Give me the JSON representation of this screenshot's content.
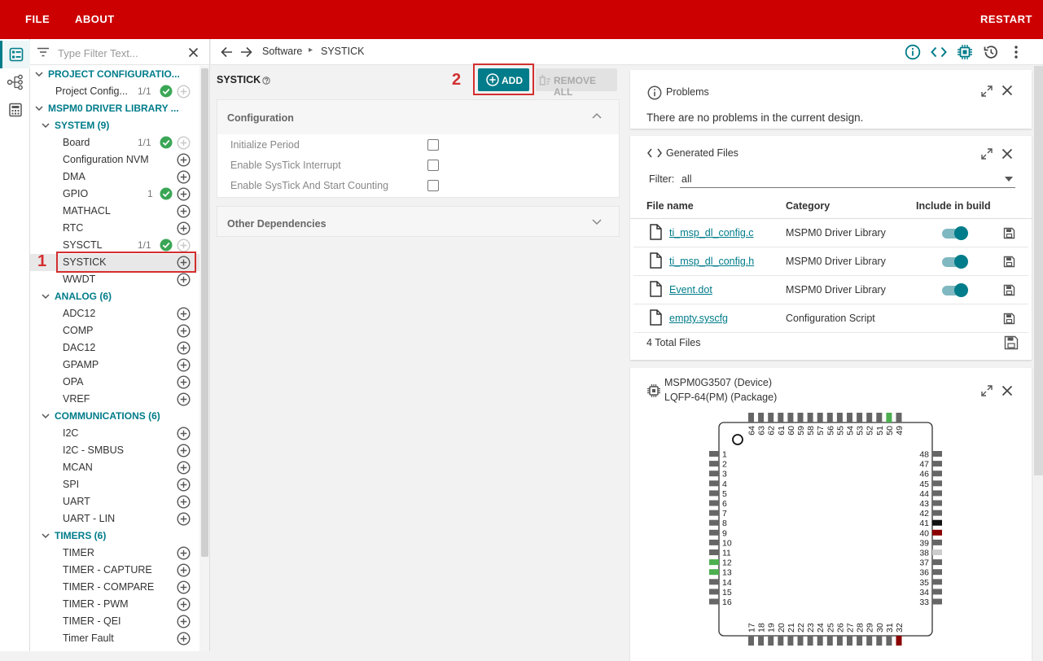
{
  "menu": {
    "file": "FILE",
    "about": "ABOUT",
    "restart": "RESTART"
  },
  "filter": {
    "placeholder": "Type Filter Text..."
  },
  "tree": {
    "project_config": {
      "title": "PROJECT CONFIGURATIO...",
      "items": [
        {
          "label": "Project Config...",
          "count": "1/1"
        }
      ]
    },
    "driver_lib": {
      "title": "MSPM0 DRIVER LIBRARY ..."
    },
    "system": {
      "title": "SYSTEM (9)",
      "items": [
        {
          "label": "Board",
          "count": "1/1"
        },
        {
          "label": "Configuration NVM",
          "count": ""
        },
        {
          "label": "DMA",
          "count": ""
        },
        {
          "label": "GPIO",
          "count": "1"
        },
        {
          "label": "MATHACL",
          "count": ""
        },
        {
          "label": "RTC",
          "count": ""
        },
        {
          "label": "SYSCTL",
          "count": "1/1"
        },
        {
          "label": "SYSTICK",
          "count": ""
        },
        {
          "label": "WWDT",
          "count": ""
        }
      ]
    },
    "analog": {
      "title": "ANALOG (6)",
      "items": [
        "ADC12",
        "COMP",
        "DAC12",
        "GPAMP",
        "OPA",
        "VREF"
      ]
    },
    "communications": {
      "title": "COMMUNICATIONS (6)",
      "items": [
        "I2C",
        "I2C - SMBUS",
        "MCAN",
        "SPI",
        "UART",
        "UART - LIN"
      ]
    },
    "timers": {
      "title": "TIMERS (6)",
      "items": [
        "TIMER",
        "TIMER - CAPTURE",
        "TIMER - COMPARE",
        "TIMER - PWM",
        "TIMER - QEI",
        "Timer Fault"
      ]
    }
  },
  "annotations": {
    "first": "1",
    "second": "2"
  },
  "breadcrumb": {
    "root": "Software",
    "current": "SYSTICK"
  },
  "module": {
    "title": "SYSTICK",
    "add_label": "ADD",
    "remove_all_label": "REMOVE ALL",
    "config_section": "Configuration",
    "options": [
      {
        "label": "Initialize Period",
        "checked": false
      },
      {
        "label": "Enable SysTick Interrupt",
        "checked": false
      },
      {
        "label": "Enable SysTick And Start Counting",
        "checked": false
      }
    ],
    "deps_section": "Other Dependencies"
  },
  "problems": {
    "title": "Problems",
    "message": "There are no problems in the current design."
  },
  "generated": {
    "title": "Generated Files",
    "filter_label": "Filter:",
    "filter_value": "all",
    "columns": [
      "File name",
      "Category",
      "Include in build"
    ],
    "files": [
      {
        "name": "ti_msp_dl_config.c",
        "category": "MSPM0 Driver Library",
        "include": true
      },
      {
        "name": "ti_msp_dl_config.h",
        "category": "MSPM0 Driver Library",
        "include": true
      },
      {
        "name": "Event.dot",
        "category": "MSPM0 Driver Library",
        "include": true
      },
      {
        "name": "empty.syscfg",
        "category": "Configuration Script",
        "include": null
      }
    ],
    "total": "4 Total Files"
  },
  "device": {
    "device_line": "MSPM0G3507 (Device)",
    "package_line": "LQFP-64(PM) (Package)",
    "pins_left": [
      "1",
      "2",
      "3",
      "4",
      "5",
      "6",
      "7",
      "8",
      "9",
      "10",
      "11",
      "12",
      "13",
      "14",
      "15",
      "16"
    ],
    "pins_bottom": [
      "17",
      "18",
      "19",
      "20",
      "21",
      "22",
      "23",
      "24",
      "25",
      "26",
      "27",
      "28",
      "29",
      "30",
      "31",
      "32"
    ],
    "pins_right": [
      "33",
      "34",
      "35",
      "36",
      "37",
      "38",
      "39",
      "40",
      "41",
      "42",
      "43",
      "44",
      "45",
      "46",
      "47",
      "48"
    ],
    "pins_top": [
      "49",
      "50",
      "51",
      "52",
      "53",
      "54",
      "55",
      "56",
      "57",
      "58",
      "59",
      "60",
      "61",
      "62",
      "63",
      "64"
    ],
    "pin_colors": {
      "default": "#666666",
      "green": "#4caf50",
      "black": "#111111",
      "darkred": "#8b0000",
      "lightgray": "#cccccc"
    },
    "green_pins": [
      "12",
      "13",
      "50"
    ],
    "black_pins": [
      "41"
    ],
    "darkred_pins": [
      "40",
      "32"
    ],
    "lightgray_pins": [
      "38"
    ]
  },
  "colors": {
    "brand": "#cc0000",
    "accent": "#007c8a",
    "ok": "#3aa655",
    "annotation": "#d32f2f"
  }
}
